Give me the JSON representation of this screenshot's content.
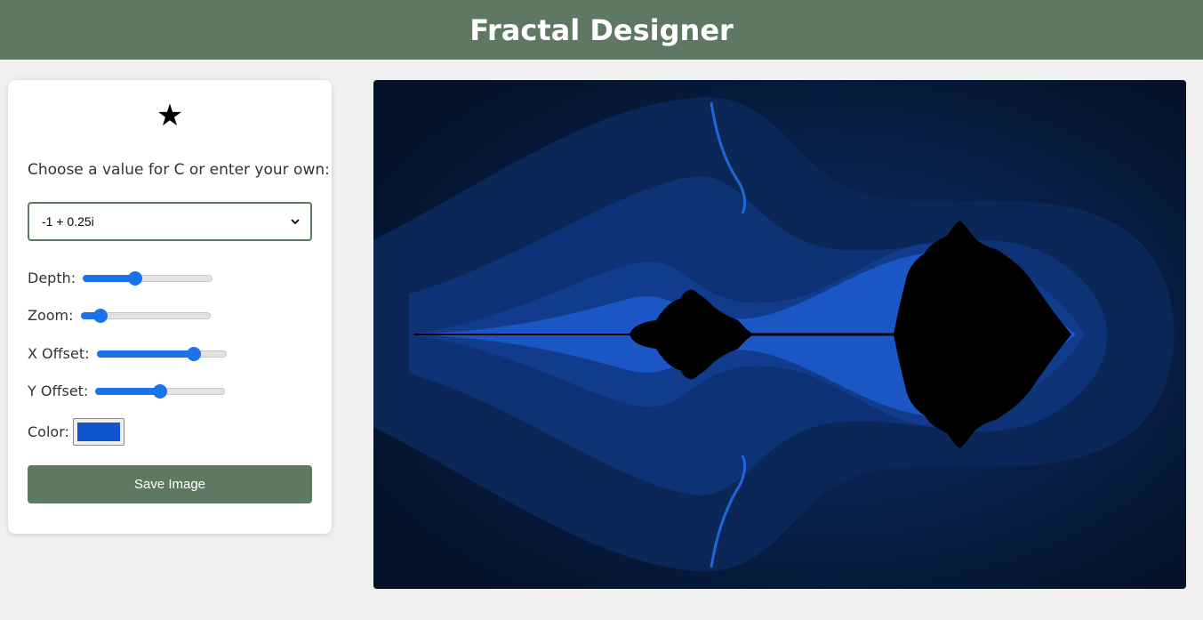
{
  "header": {
    "title": "Fractal Designer"
  },
  "panel": {
    "star_glyph": "★",
    "prompt": "Choose a value for C or enter your own:",
    "c_select": {
      "selected": "-1 + 0.25i"
    },
    "sliders": [
      {
        "label": "Depth:",
        "value": 0.4
      },
      {
        "label": "Zoom:",
        "value": 0.15
      },
      {
        "label": "X Offset:",
        "value": 0.75
      },
      {
        "label": "Y Offset:",
        "value": 0.5
      }
    ],
    "color": {
      "label": "Color:",
      "value": "#1155cc"
    },
    "save_label": "Save Image"
  },
  "colors": {
    "header": "#5e7862",
    "accent": "#1a73e8",
    "fractal_background": "#051634",
    "fractal_set": "#000000"
  }
}
